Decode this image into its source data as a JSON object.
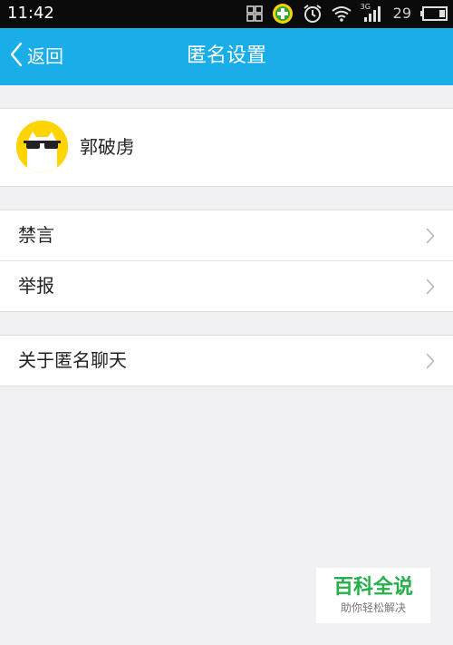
{
  "status_bar": {
    "time": "11:42",
    "network_label": "3G",
    "battery_level": "29",
    "icons": [
      "screen-grid-icon",
      "health-plus-icon",
      "alarm-icon",
      "wifi-icon",
      "signal-icon",
      "battery-icon"
    ]
  },
  "header": {
    "back_label": "返回",
    "title": "匿名设置",
    "colors": {
      "background": "#1aaee9",
      "text": "#ffffff"
    }
  },
  "profile": {
    "name": "郭破虏",
    "avatar_icon": "sunglasses-cat-avatar"
  },
  "menu_group_1": {
    "items": [
      {
        "label": "禁言"
      },
      {
        "label": "举报"
      }
    ]
  },
  "menu_group_2": {
    "items": [
      {
        "label": "关于匿名聊天"
      }
    ]
  },
  "watermark": {
    "title": "百科全说",
    "subtitle": "助你轻松解决",
    "color": "#25b04a"
  }
}
